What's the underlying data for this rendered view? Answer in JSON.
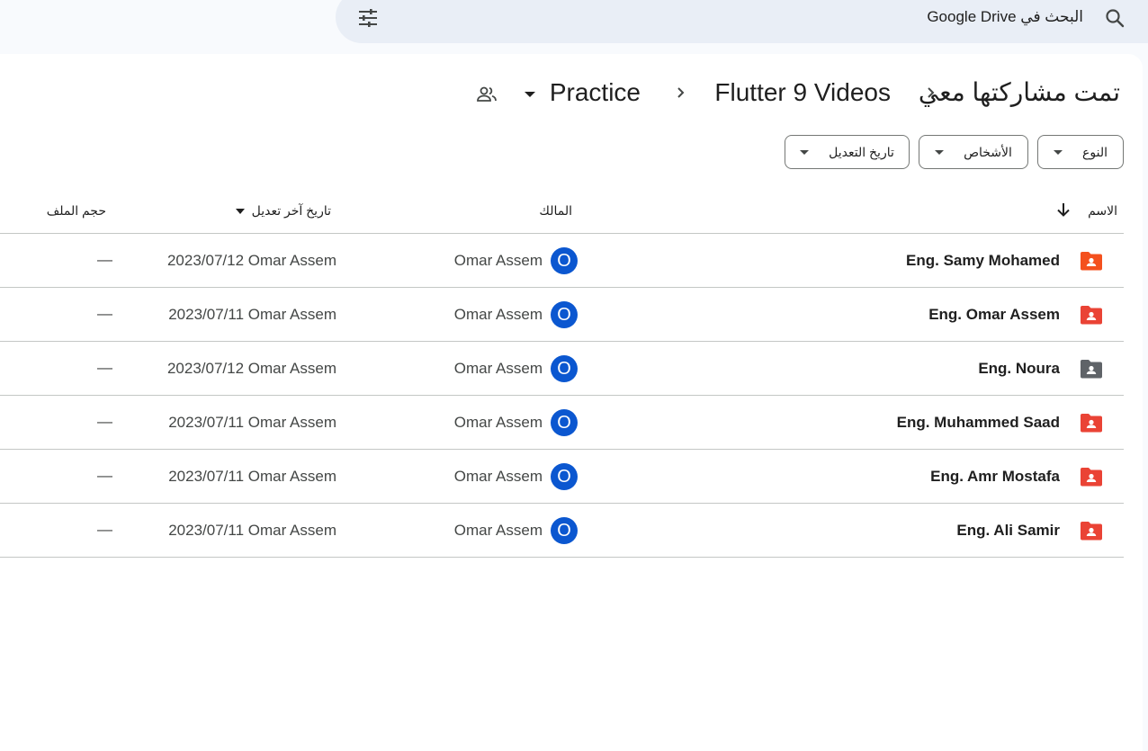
{
  "search": {
    "placeholder": "البحث في Google Drive"
  },
  "breadcrumb": {
    "shared": "تمت مشاركتها معي",
    "parent": "Flutter 9 Videos",
    "current": "Practice"
  },
  "filters": {
    "type": "النوع",
    "people": "الأشخاص",
    "modified": "تاريخ التعديل"
  },
  "table": {
    "headers": {
      "name": "الاسم",
      "owner": "المالك",
      "last_modified": "تاريخ آخر تعديل",
      "size": "حجم الملف"
    },
    "rows": [
      {
        "name": "Eng. Samy Mohamed",
        "owner": "Omar Assem",
        "avatar": "O",
        "modified": "2023/07/12 Omar Assem",
        "size": "—",
        "icon_color": "#f4511e"
      },
      {
        "name": "Eng. Omar Assem",
        "owner": "Omar Assem",
        "avatar": "O",
        "modified": "2023/07/11 Omar Assem",
        "size": "—",
        "icon_color": "#ea4335"
      },
      {
        "name": "Eng. Noura",
        "owner": "Omar Assem",
        "avatar": "O",
        "modified": "2023/07/12 Omar Assem",
        "size": "—",
        "icon_color": "#5f6368"
      },
      {
        "name": "Eng. Muhammed Saad",
        "owner": "Omar Assem",
        "avatar": "O",
        "modified": "2023/07/11 Omar Assem",
        "size": "—",
        "icon_color": "#ea4335"
      },
      {
        "name": "Eng. Amr Mostafa",
        "owner": "Omar Assem",
        "avatar": "O",
        "modified": "2023/07/11 Omar Assem",
        "size": "—",
        "icon_color": "#ea4335"
      },
      {
        "name": "Eng. Ali Samir",
        "owner": "Omar Assem",
        "avatar": "O",
        "modified": "2023/07/11 Omar Assem",
        "size": "—",
        "icon_color": "#ea4335"
      }
    ]
  },
  "colors": {
    "accent": "#0b57d0",
    "search_bg": "#e9eef6",
    "page_bg": "#f8fafd"
  }
}
